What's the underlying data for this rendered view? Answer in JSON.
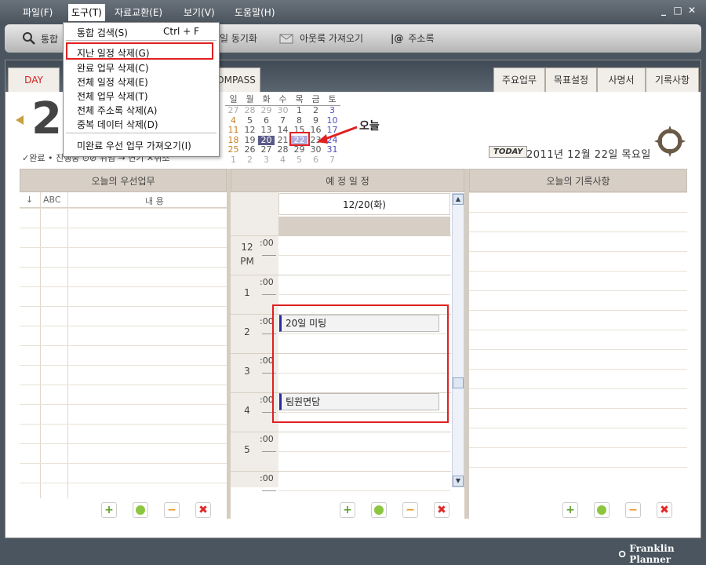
{
  "menu": [
    "파일(F)",
    "도구(T)",
    "자료교환(E)",
    "보기(V)",
    "도움말(H)"
  ],
  "window_controls": [
    "_",
    "□",
    "✕"
  ],
  "toolbar": {
    "search": "통합",
    "sync": "일 동기화",
    "outlook": "아웃룩 가져오기",
    "contacts": "주소록"
  },
  "dropdown": [
    {
      "label": "통합 검색(S)",
      "shortcut": "Ctrl + F"
    },
    {
      "label": "지난 일정 삭제(G)"
    },
    {
      "label": "완료 업무 삭제(C)"
    },
    {
      "label": "전체 일정 삭제(E)"
    },
    {
      "label": "전체 업무 삭제(T)"
    },
    {
      "label": "전체 주소록 삭제(A)"
    },
    {
      "label": "중복 데이터 삭제(D)"
    },
    {
      "label": "미완료 우선 업무 가져오기(I)"
    }
  ],
  "tabs": {
    "day": "DAY",
    "compass": "OMPASS"
  },
  "right_tabs": [
    "주요업무",
    "목표설정",
    "사명서",
    "기록사항"
  ],
  "big_date": "2",
  "status_legend": "✓완료  • 진행중  ⊙⊘ 위임  → 연기  ✕취소",
  "calendar": {
    "weekdays": [
      "일",
      "월",
      "화",
      "수",
      "목",
      "금",
      "토"
    ],
    "rows": [
      [
        "27",
        "28",
        "29",
        "30",
        "1",
        "2",
        "3"
      ],
      [
        "4",
        "5",
        "6",
        "7",
        "8",
        "9",
        "10"
      ],
      [
        "11",
        "12",
        "13",
        "14",
        "15",
        "16",
        "17"
      ],
      [
        "18",
        "19",
        "20",
        "21",
        "22",
        "23",
        "24"
      ],
      [
        "25",
        "26",
        "27",
        "28",
        "29",
        "30",
        "31"
      ],
      [
        "1",
        "2",
        "3",
        "4",
        "5",
        "6",
        "7"
      ]
    ]
  },
  "today_annotation": "오늘",
  "today_badge": "TODAY",
  "today_date": "2011년 12월 22일 목요일",
  "panels": {
    "left": {
      "title": "오늘의 우선업무",
      "cols": [
        "↓",
        "ABC",
        "내 용"
      ]
    },
    "middle": {
      "title": "예 정 일 정",
      "date": "12/20(화)"
    },
    "right": {
      "title": "오늘의 기록사항"
    }
  },
  "hours": [
    {
      "hour": "12",
      "sub": "PM",
      "min": ":00"
    },
    {
      "hour": "1",
      "sub": "",
      "min": ":00"
    },
    {
      "hour": "2",
      "sub": "",
      "min": ":00"
    },
    {
      "hour": "3",
      "sub": "",
      "min": ":00"
    },
    {
      "hour": "4",
      "sub": "",
      "min": ":00"
    },
    {
      "hour": "5",
      "sub": "",
      "min": ":00"
    },
    {
      "hour": "",
      "sub": "",
      "min": ":00"
    }
  ],
  "events": [
    "20일 미팅",
    "팀원면담"
  ],
  "brand": "Franklin Planner",
  "colors": {
    "accent_red": "#e02020",
    "event_bar": "#2a2aa0",
    "header_bg": "#d7cfc5"
  }
}
